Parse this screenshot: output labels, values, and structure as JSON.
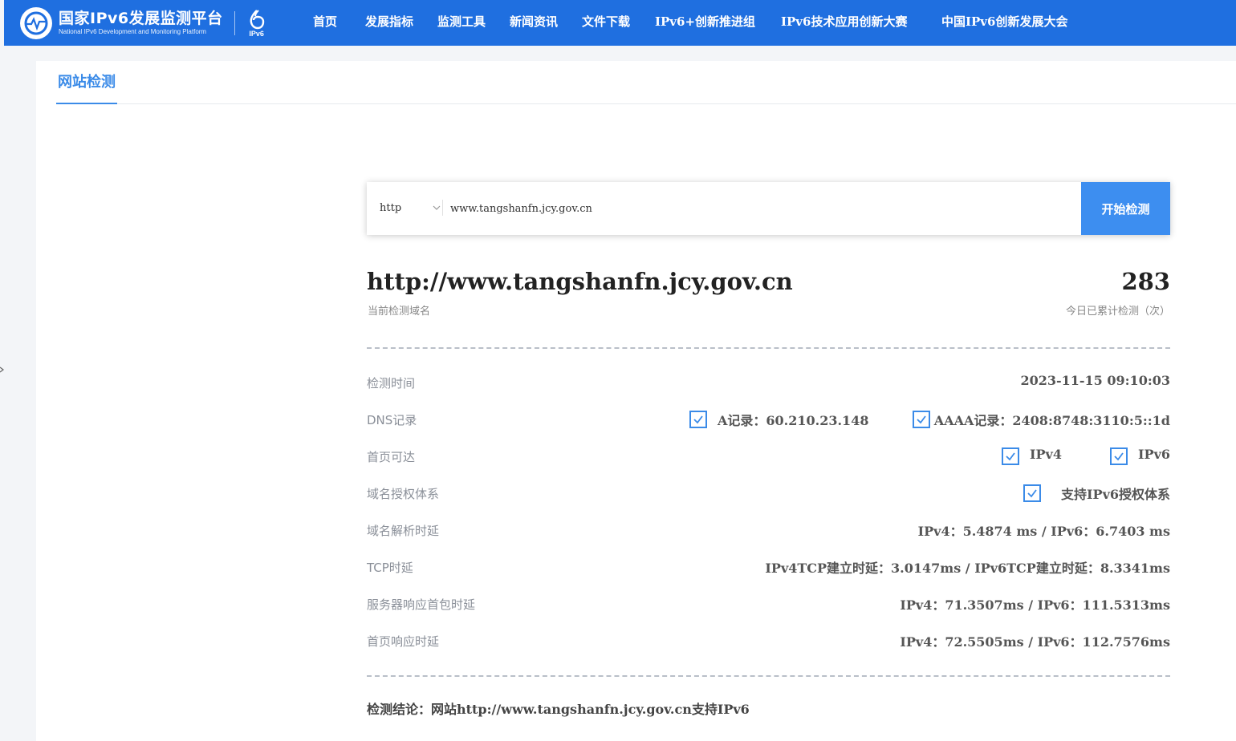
{
  "header": {
    "logo_cn": "国家IPv6发展监测平台",
    "logo_en": "National IPv6 Development and Monitoring Platform",
    "logo_badge": "IPv6",
    "brand_color": "#1f6fe0",
    "nav": [
      "首页",
      "发展指标",
      "监测工具",
      "新闻资讯",
      "文件下载",
      "IPv6+创新推进组",
      "IPv6技术应用创新大赛",
      "中国IPv6创新发展大会"
    ]
  },
  "tabs": {
    "active": "网站检测"
  },
  "search": {
    "protocol": "http",
    "url_value": "www.tangshanfn.jcy.gov.cn",
    "button": "开始检测",
    "accent_color": "#3d8ef0"
  },
  "result": {
    "domain": "http://www.tangshanfn.jcy.gov.cn",
    "domain_caption": "当前检测域名",
    "count": "283",
    "count_caption": "今日已累计检测（次）",
    "rows": {
      "time": {
        "label": "检测时间",
        "value": "2023-11-15 09:10:03"
      },
      "dns": {
        "label": "DNS记录",
        "a_record": "A记录：60.210.23.148",
        "aaaa_record": "AAAA记录：2408:8748:3110:5::1d"
      },
      "homepage": {
        "label": "首页可达",
        "ipv4": "IPv4",
        "ipv6": "IPv6"
      },
      "auth": {
        "label": "域名授权体系",
        "value": "支持IPv6授权体系"
      },
      "dns_latency": {
        "label": "域名解析时延",
        "value": "IPv4：5.4874 ms / IPv6：6.7403 ms"
      },
      "tcp": {
        "label": "TCP时延",
        "value": "IPv4TCP建立时延：3.0147ms / IPv6TCP建立时延：8.3341ms"
      },
      "first_packet": {
        "label": "服务器响应首包时延",
        "value": "IPv4：71.3507ms / IPv6：111.5313ms"
      },
      "page_response": {
        "label": "首页响应时延",
        "value": "IPv4：72.5505ms / IPv6：112.7576ms"
      }
    },
    "conclusion": "检测结论：网站http://www.tangshanfn.jcy.gov.cn支持IPv6"
  }
}
